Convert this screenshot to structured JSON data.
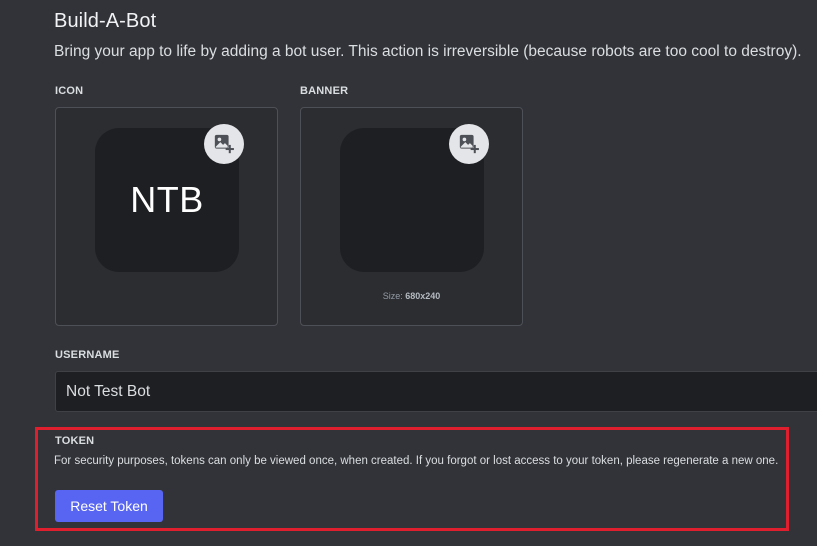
{
  "section": {
    "title": "Build-A-Bot",
    "description": "Bring your app to life by adding a bot user. This action is irreversible (because robots are too cool to destroy)."
  },
  "icon": {
    "label": "ICON",
    "initials": "NTB",
    "edit_icon": "add-image-icon"
  },
  "banner": {
    "label": "BANNER",
    "size_prefix": "Size: ",
    "size_value": "680x240",
    "edit_icon": "add-image-icon"
  },
  "username": {
    "label": "USERNAME",
    "value": "Not Test Bot"
  },
  "token": {
    "label": "TOKEN",
    "description": "For security purposes, tokens can only be viewed once, when created. If you forgot or lost access to your token, please regenerate a new one.",
    "reset_label": "Reset Token"
  },
  "colors": {
    "background": "#313338",
    "accent": "#5865f2",
    "highlight_border": "#e01f2e"
  }
}
